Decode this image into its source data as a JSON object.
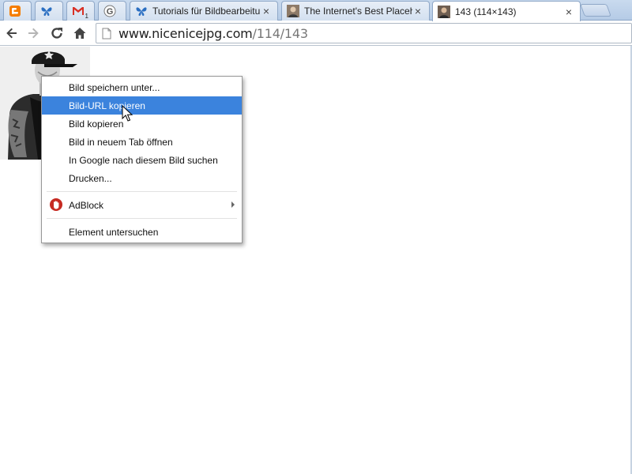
{
  "tabs": [
    {
      "title": "",
      "icon": "blogger-icon",
      "active": false
    },
    {
      "title": "",
      "icon": "butterfly-icon",
      "active": false
    },
    {
      "title": "",
      "icon": "gmail-icon",
      "badge": "1",
      "active": false
    },
    {
      "title": "",
      "icon": "google-icon",
      "active": false
    },
    {
      "title": "Tutorials für Bildbearbeitu",
      "icon": "butterfly-icon",
      "active": false
    },
    {
      "title": "The Internet's Best Placeh",
      "icon": "avatar-icon",
      "active": false
    },
    {
      "title": "143 (114×143)",
      "icon": "image-thumb-icon",
      "active": true
    }
  ],
  "toolbar": {
    "url_host": "www.nicenicejpg.com",
    "url_path": "/114/143"
  },
  "context_menu": {
    "items": [
      {
        "label": "Bild speichern unter..."
      },
      {
        "label": "Bild-URL kopieren",
        "highlighted": true
      },
      {
        "label": "Bild kopieren"
      },
      {
        "label": "Bild in neuem Tab öffnen"
      },
      {
        "label": "In Google nach diesem Bild suchen"
      },
      {
        "label": "Drucken..."
      },
      {
        "label": "AdBlock",
        "icon": "adblock-icon",
        "submenu": true
      },
      {
        "label": "Element untersuchen"
      }
    ]
  },
  "colors": {
    "menu_highlight": "#3b83dd",
    "adblock_red": "#c62a22",
    "tabstrip": "#c9daee"
  }
}
